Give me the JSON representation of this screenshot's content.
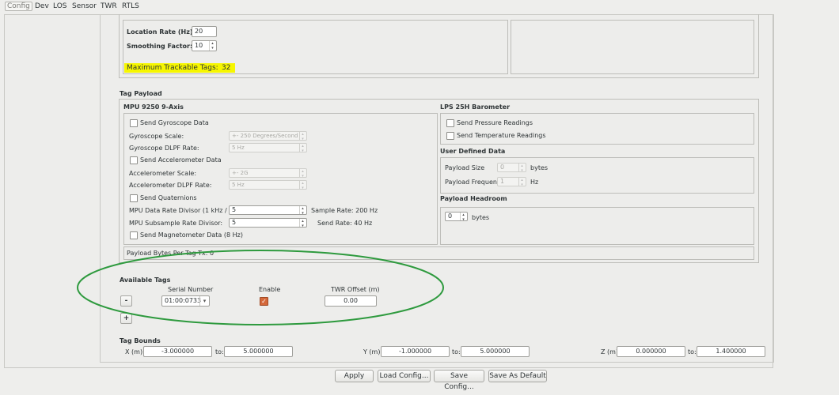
{
  "menu": {
    "items": [
      "Config",
      "Dev",
      "LOS",
      "Sensor",
      "TWR",
      "RTLS"
    ]
  },
  "location": {
    "rate_label": "Location Rate (Hz):",
    "rate_value": "20",
    "smoothing_label": "Smoothing Factor:",
    "smoothing_value": "10",
    "max_tags_label": "Maximum Trackable Tags:",
    "max_tags_value": "32"
  },
  "tag_payload": {
    "title": "Tag Payload",
    "mpu": {
      "title": "MPU 9250 9-Axis",
      "send_gyro": "Send Gyroscope Data",
      "gyro_scale_label": "Gyroscope Scale:",
      "gyro_scale_value": "+- 250 Degrees/Second",
      "gyro_dlpf_label": "Gyroscope DLPF Rate:",
      "gyro_dlpf_value": "5 Hz",
      "send_accel": "Send Accelerometer Data",
      "accel_scale_label": "Accelerometer Scale:",
      "accel_scale_value": "+- 2G",
      "accel_dlpf_label": "Accelerometer DLPF Rate:",
      "accel_dlpf_value": "5 Hz",
      "send_quat": "Send Quaternions",
      "rate_divisor_label": "MPU Data Rate Divisor (1 kHz / val):",
      "rate_divisor_value": "5",
      "sample_rate_text": "Sample Rate: 200 Hz",
      "subsample_label": "MPU Subsample Rate Divisor:",
      "subsample_value": "5",
      "send_rate_text": "Send Rate: 40 Hz",
      "send_mag": "Send Magnetometer Data (8 Hz)"
    },
    "lps": {
      "title": "LPS 25H Barometer",
      "send_pressure": "Send Pressure Readings",
      "send_temp": "Send Temperature Readings"
    },
    "user_defined": {
      "title": "User Defined Data",
      "size_label": "Payload Size",
      "size_value": "0",
      "size_unit": "bytes",
      "freq_label": "Payload Frequency",
      "freq_value": "1",
      "freq_unit": "Hz"
    },
    "headroom": {
      "title": "Payload Headroom",
      "value": "0",
      "unit": "bytes"
    },
    "bytes_per_tag": "Payload Bytes Per Tag Tx:  0"
  },
  "available_tags": {
    "title": "Available Tags",
    "columns": [
      "Serial Number",
      "Enable",
      "TWR Offset (m)"
    ],
    "rows": [
      {
        "serial": "01:00:0733",
        "enabled": true,
        "offset": "0.00"
      }
    ],
    "remove_label": "-",
    "add_label": "+"
  },
  "tag_bounds": {
    "title": "Tag Bounds",
    "x_label": "X (m):",
    "x_min": "-3.000000",
    "x_to": "to:",
    "x_max": "5.000000",
    "y_label": "Y (m):",
    "y_min": "-1.000000",
    "y_to": "to:",
    "y_max": "5.000000",
    "z_label": "Z (m):",
    "z_min": "0.000000",
    "z_to": "to:",
    "z_max": "1.400000"
  },
  "buttons": {
    "apply": "Apply",
    "load": "Load Config...",
    "save": "Save Config...",
    "save_default": "Save As Default"
  },
  "colors": {
    "highlight": "#f6f600",
    "annotation_ellipse": "#2e9a3e",
    "checkbox_checked": "#d4683a"
  }
}
